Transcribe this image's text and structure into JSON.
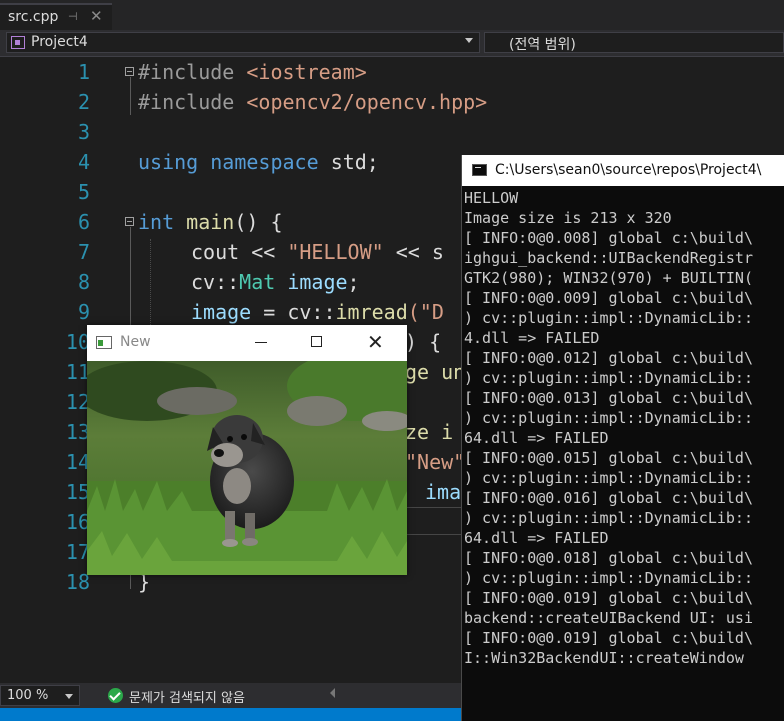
{
  "tab": {
    "label": "src.cpp"
  },
  "nav": {
    "project": "Project4",
    "scope": "(전역 범위)"
  },
  "editor": {
    "line_numbers": [
      "1",
      "2",
      "3",
      "4",
      "5",
      "6",
      "7",
      "8",
      "9",
      "10",
      "11",
      "12",
      "13",
      "14",
      "15",
      "16",
      "17",
      "18"
    ],
    "line1": {
      "pp": "#include",
      "arg": "<iostream>"
    },
    "line2": {
      "pp": "#include",
      "arg": "<opencv2/opencv.hpp>"
    },
    "line4": {
      "kw1": "using",
      "kw2": "namespace",
      "rest": "std;"
    },
    "line6": {
      "kw": "int",
      "fn": "main",
      "rest": "() {"
    },
    "line7": {
      "a": "cout << ",
      "str": "\"HELLOW\"",
      "b": " << s"
    },
    "line8": {
      "ns": "cv::",
      "ty": "Mat",
      "var": " image",
      "rest": ";"
    },
    "line9": {
      "var": "image",
      "a": " = cv::",
      "fn": "imread",
      "b": "(\"D"
    },
    "line10": {
      "rest": ") {"
    },
    "line11": {
      "rest": "ge un"
    },
    "line13": {
      "rest": "ze i"
    },
    "line14": {
      "str": "\"New\""
    },
    "line15": {
      "var": "ima"
    },
    "line18": {
      "rest": "}"
    }
  },
  "console": {
    "title": "C:\\Users\\sean0\\source\\repos\\Project4\\",
    "lines": [
      "HELLOW",
      "Image size is 213 x 320",
      "[ INFO:0@0.008] global c:\\build\\",
      "ighgui_backend::UIBackendRegistr",
      "GTK2(980); WIN32(970) + BUILTIN(",
      "[ INFO:0@0.009] global c:\\build\\",
      ") cv::plugin::impl::DynamicLib::",
      "4.dll => FAILED",
      "[ INFO:0@0.012] global c:\\build\\",
      ") cv::plugin::impl::DynamicLib::",
      "[ INFO:0@0.013] global c:\\build\\",
      ") cv::plugin::impl::DynamicLib::",
      "64.dll => FAILED",
      "[ INFO:0@0.015] global c:\\build\\",
      ") cv::plugin::impl::DynamicLib::",
      "[ INFO:0@0.016] global c:\\build\\",
      ") cv::plugin::impl::DynamicLib::",
      "64.dll => FAILED",
      "[ INFO:0@0.018] global c:\\build\\",
      ") cv::plugin::impl::DynamicLib::",
      "[ INFO:0@0.019] global c:\\build\\",
      "backend::createUIBackend UI: usi",
      "[ INFO:0@0.019] global c:\\build\\",
      "I::Win32BackendUI::createWindow"
    ]
  },
  "image_window": {
    "title": "New"
  },
  "status": {
    "zoom": "100 %",
    "issues": "문제가 검색되지 않음"
  }
}
